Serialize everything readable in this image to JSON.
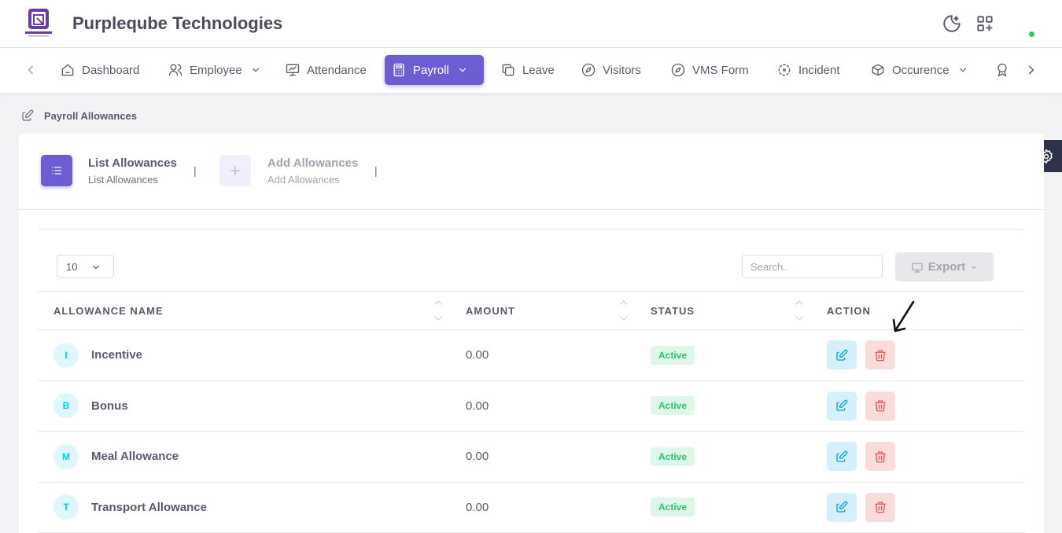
{
  "header": {
    "brand": "Purpleqube Technologies"
  },
  "nav": {
    "items": [
      {
        "label": "Dashboard",
        "icon": "home-icon"
      },
      {
        "label": "Employee",
        "icon": "users-icon"
      },
      {
        "label": "Attendance",
        "icon": "presentation-icon"
      },
      {
        "label": "Payroll",
        "icon": "calculator-icon"
      },
      {
        "label": "Leave",
        "icon": "copy-icon"
      },
      {
        "label": "Visitors",
        "icon": "compass-icon"
      },
      {
        "label": "VMS Form",
        "icon": "compass-icon"
      },
      {
        "label": "Incident",
        "icon": "focus-icon"
      },
      {
        "label": "Occurence",
        "icon": "box-icon"
      }
    ],
    "active": "Payroll"
  },
  "breadcrumb": "Payroll Allowances",
  "steps": [
    {
      "title": "List Allowances",
      "subtitle": "List Allowances",
      "active": true
    },
    {
      "title": "Add Allowances",
      "subtitle": "Add Allowances",
      "active": false
    }
  ],
  "step_separator": "|",
  "table_controls": {
    "page_length": "10",
    "search_placeholder": "Search..",
    "export_label": "Export"
  },
  "table": {
    "headers": [
      "ALLOWANCE NAME",
      "AMOUNT",
      "STATUS",
      "ACTION"
    ],
    "rows": [
      {
        "initial": "I",
        "name": "Incentive",
        "amount": "0.00",
        "status": "Active"
      },
      {
        "initial": "B",
        "name": "Bonus",
        "amount": "0.00",
        "status": "Active"
      },
      {
        "initial": "M",
        "name": "Meal Allowance",
        "amount": "0.00",
        "status": "Active"
      },
      {
        "initial": "T",
        "name": "Transport Allowance",
        "amount": "0.00",
        "status": "Active"
      }
    ]
  },
  "colors": {
    "accent": "#6c5dd3",
    "status_active": "#28c76f",
    "edit": "#00a0dc",
    "delete": "#ea5455"
  }
}
